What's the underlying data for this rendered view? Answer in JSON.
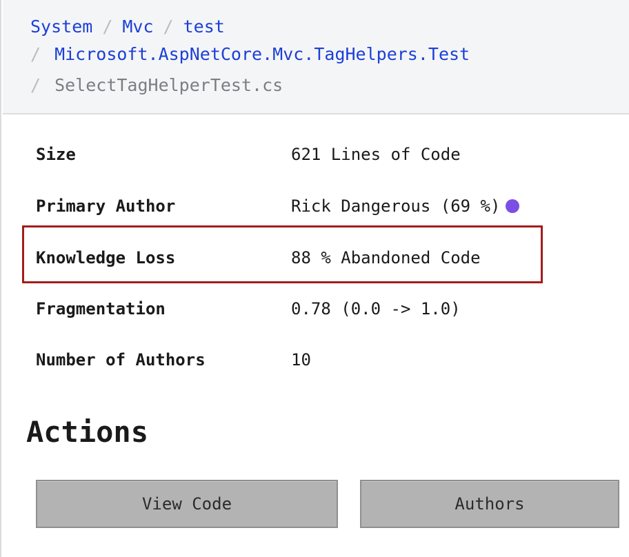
{
  "breadcrumb": {
    "items": [
      {
        "label": "System"
      },
      {
        "label": "Mvc"
      },
      {
        "label": "test"
      },
      {
        "label": "Microsoft.AspNetCore.Mvc.TagHelpers.Test"
      }
    ],
    "current": "SelectTagHelperTest.cs",
    "separator": "/"
  },
  "properties": {
    "size": {
      "label": "Size",
      "value": "621 Lines of Code"
    },
    "primary_author": {
      "label": "Primary Author",
      "value": "Rick Dangerous (69 %)",
      "dot_color": "#7b4ee6"
    },
    "knowledge_loss": {
      "label": "Knowledge Loss",
      "value": "88 % Abandoned Code"
    },
    "fragmentation": {
      "label": "Fragmentation",
      "value": "0.78 (0.0 -> 1.0)"
    },
    "number_of_authors": {
      "label": "Number of Authors",
      "value": "10"
    }
  },
  "actions": {
    "title": "Actions",
    "view_code_label": "View Code",
    "authors_label": "Authors"
  },
  "colors": {
    "link": "#1c3fd6",
    "highlight_border": "#a31c1c",
    "button_bg": "#b3b3b3"
  }
}
